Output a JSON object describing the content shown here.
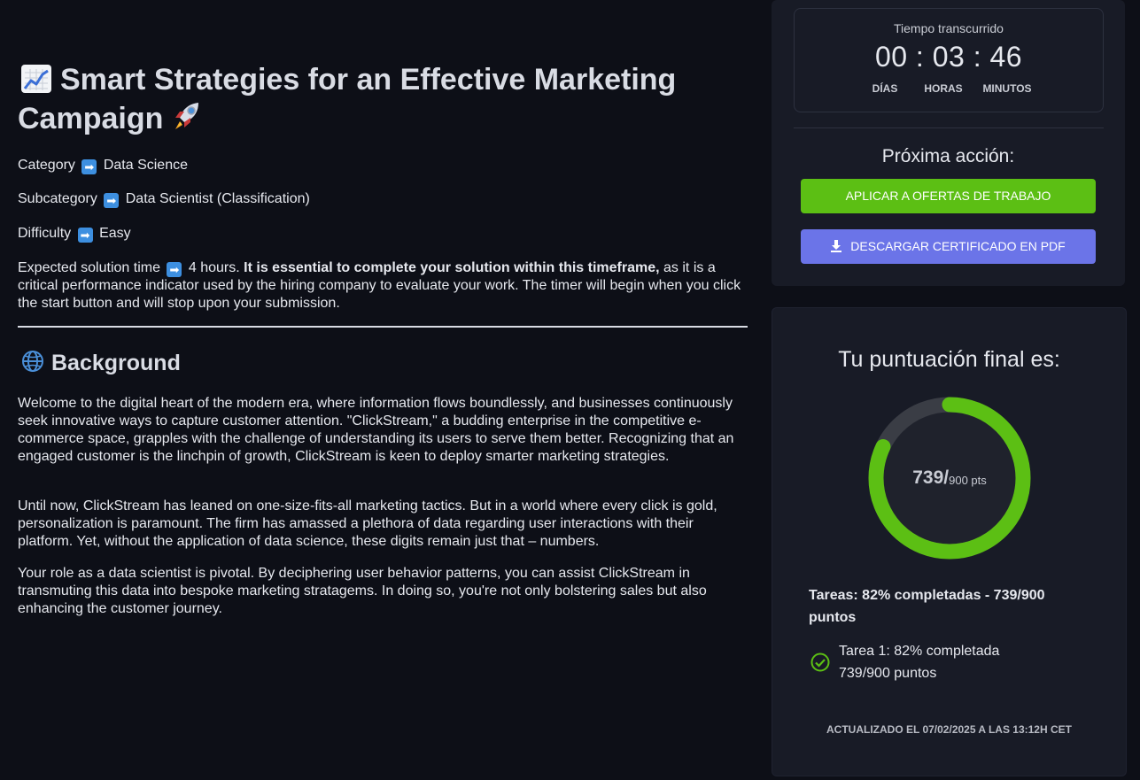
{
  "header": {
    "title": "Smart Strategies for an Effective Marketing Campaign"
  },
  "meta": {
    "category_label": "Category",
    "category_value": "Data Science",
    "subcategory_label": "Subcategory",
    "subcategory_value": "Data Scientist (Classification)",
    "difficulty_label": "Difficulty",
    "difficulty_value": "Easy",
    "expected_label": "Expected solution time",
    "expected_value": "4 hours.",
    "expected_bold": "It is essential to complete your solution within this timeframe,",
    "expected_rest": " as it is a critical performance indicator used by the hiring company to evaluate your work. The timer will begin when you click the start button and will stop upon your submission."
  },
  "background": {
    "heading": "Background",
    "paragraphs": [
      "Welcome to the digital heart of the modern era, where information flows boundlessly, and businesses continuously seek innovative ways to capture customer attention. \"ClickStream,\" a budding enterprise in the competitive e-commerce space, grapples with the challenge of understanding its users to serve them better. Recognizing that an engaged customer is the linchpin of growth, ClickStream is keen to deploy smarter marketing strategies.",
      "Until now, ClickStream has leaned on one-size-fits-all marketing tactics. But in a world where every click is gold, personalization is paramount. The firm has amassed a plethora of data regarding user interactions with their platform. Yet, without the application of data science, these digits remain just that – numbers.",
      "Your role as a data scientist is pivotal. By deciphering user behavior patterns, you can assist ClickStream in transmuting this data into bespoke marketing stratagems. In doing so, you're not only bolstering sales but also enhancing the customer journey."
    ]
  },
  "timer": {
    "label": "Tiempo transcurrido",
    "days": "00",
    "hours": "03",
    "minutes": "46",
    "separator": ":",
    "unit_days": "DÍAS",
    "unit_hours": "HORAS",
    "unit_minutes": "MINUTOS"
  },
  "next_action": {
    "heading": "Próxima acción:",
    "apply_label": "APLICAR A OFERTAS DE TRABAJO",
    "download_label": "DESCARGAR CERTIFICADO EN PDF",
    "apply_color": "#5cbf14",
    "download_color": "#6b74e8"
  },
  "score": {
    "heading": "Tu puntuación final es:",
    "points": "739/",
    "total": "900 pts",
    "progress": 0.82,
    "ring_color": "#5cbf14",
    "track_color": "#3a3d45",
    "tasks_summary": "Tareas: 82% completadas - 739/900 puntos",
    "task1_line1": "Tarea 1: 82% completada",
    "task1_line2": "739/900 puntos",
    "updated": "ACTUALIZADO EL 07/02/2025 A LAS 13:12H CET"
  }
}
